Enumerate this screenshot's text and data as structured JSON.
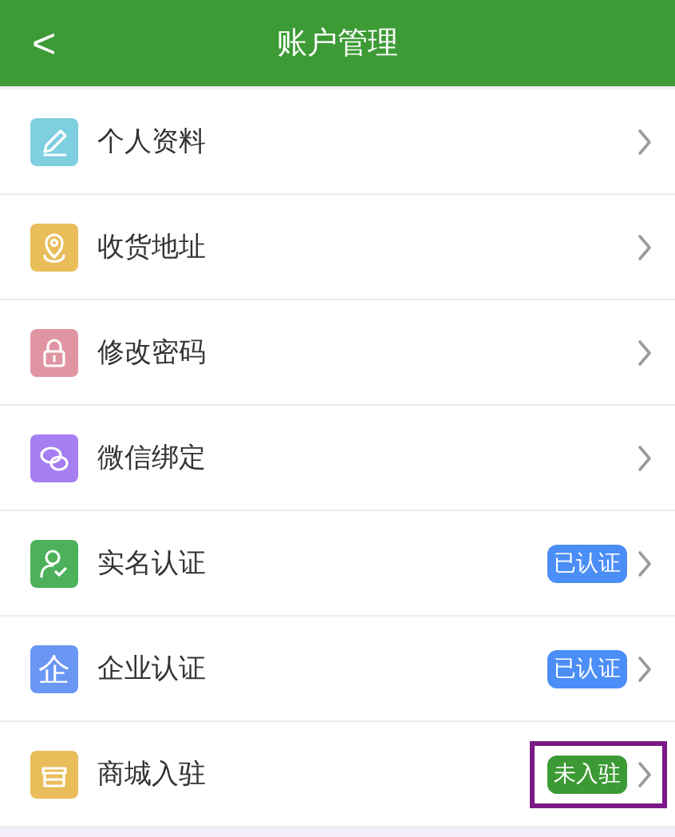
{
  "header": {
    "back": "<",
    "title": "账户管理"
  },
  "items": [
    {
      "label": "个人资料",
      "kind": "pencil",
      "color": "#7ecfe0",
      "highlighted": false
    },
    {
      "label": "收货地址",
      "kind": "pin",
      "color": "#e8bd5a",
      "highlighted": false
    },
    {
      "label": "修改密码",
      "kind": "lock",
      "color": "#e095a3",
      "highlighted": false
    },
    {
      "label": "微信绑定",
      "kind": "chat",
      "color": "#a57ef2",
      "highlighted": false
    },
    {
      "label": "实名认证",
      "kind": "person",
      "color": "#4db05a",
      "highlighted": false,
      "badge": {
        "text": "已认证",
        "color": "#4b8ef7"
      }
    },
    {
      "label": "企业认证",
      "kind": "glyph",
      "icon_text": "企",
      "color": "#6a96f4",
      "highlighted": false,
      "badge": {
        "text": "已认证",
        "color": "#4b8ef7"
      }
    },
    {
      "label": "商城入驻",
      "kind": "shop",
      "color": "#e8bd5a",
      "highlighted": true,
      "badge": {
        "text": "未入驻",
        "color": "#3c9a34"
      }
    }
  ]
}
